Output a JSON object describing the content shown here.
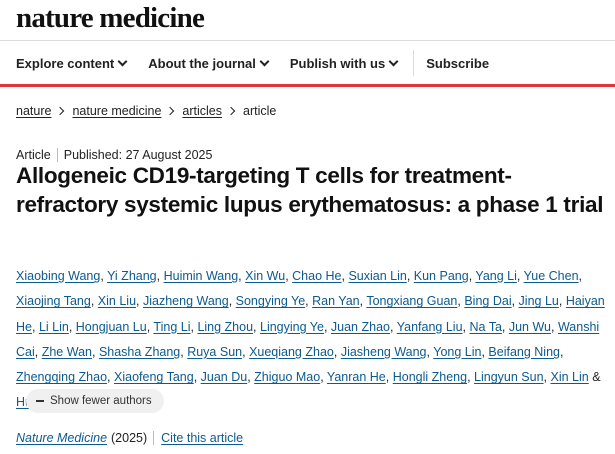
{
  "site": {
    "logo": "nature medicine"
  },
  "nav": {
    "items": [
      {
        "label": "Explore content",
        "dropdown": true
      },
      {
        "label": "About the journal",
        "dropdown": true
      },
      {
        "label": "Publish with us",
        "dropdown": true
      }
    ],
    "subscribe": "Subscribe"
  },
  "breadcrumb": [
    "nature",
    "nature medicine",
    "articles",
    "article"
  ],
  "article": {
    "type": "Article",
    "published": "Published: 27 August 2025",
    "title": "Allogeneic CD19-targeting T cells for treatment-refractory systemic lupus erythematosus: a phase 1 trial",
    "authors": [
      "Xiaobing Wang",
      "Yi Zhang",
      "Huimin Wang",
      "Xin Wu",
      "Chao He",
      "Suxian Lin",
      "Kun Pang",
      "Yang Li",
      "Yue Chen",
      "Xiaojing Tang",
      "Xin Liu",
      "Jiazheng Wang",
      "Songying Ye",
      "Ran Yan",
      "Tongxiang Guan",
      "Bing Dai",
      "Jing Lu",
      "Haiyan He",
      "Li Lin",
      "Hongjuan Lu",
      "Ting Li",
      "Ling Zhou",
      "Lingying Ye",
      "Juan Zhao",
      "Yanfang Liu",
      "Na Ta",
      "Jun Wu",
      "Wanshi Cai",
      "Zhe Wan",
      "Shasha Zhang",
      "Ruya Sun",
      "Xueqiang Zhao",
      "Jiasheng Wang",
      "Yong Lin",
      "Beifang Ning",
      "Zhengqing Zhao",
      "Xiaofeng Tang",
      "Juan Du",
      "Zhiguo Mao",
      "Yanran He",
      "Hongli Zheng",
      "Lingyun Sun",
      "Xin Lin",
      "Huji Xu"
    ],
    "corresponding_icon": "mail-icon",
    "show_fewer": "Show fewer authors",
    "journal": "Nature Medicine",
    "year": "(2025)",
    "cite": "Cite this article"
  },
  "colors": {
    "accent_rule": "#e0343c",
    "link": "#0c5a8e"
  }
}
